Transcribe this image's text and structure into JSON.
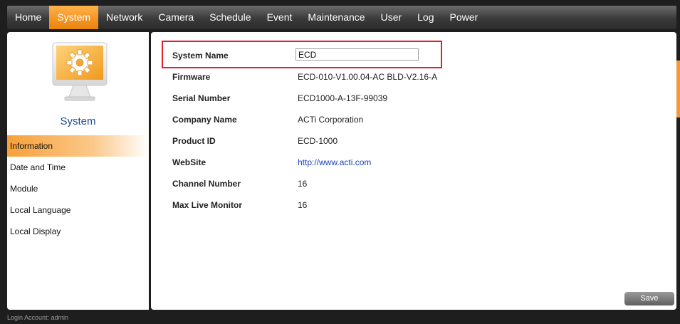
{
  "nav": {
    "tabs": [
      {
        "label": "Home"
      },
      {
        "label": "System"
      },
      {
        "label": "Network"
      },
      {
        "label": "Camera"
      },
      {
        "label": "Schedule"
      },
      {
        "label": "Event"
      },
      {
        "label": "Maintenance"
      },
      {
        "label": "User"
      },
      {
        "label": "Log"
      },
      {
        "label": "Power"
      }
    ],
    "active": "System"
  },
  "sidebar": {
    "title": "System",
    "icon": "gear-monitor-icon",
    "items": [
      {
        "label": "Information"
      },
      {
        "label": "Date and Time"
      },
      {
        "label": "Module"
      },
      {
        "label": "Local Language"
      },
      {
        "label": "Local Display"
      }
    ],
    "active": "Information"
  },
  "info": {
    "system_name": {
      "label": "System Name",
      "value": "ECD"
    },
    "firmware": {
      "label": "Firmware",
      "value": "ECD-010-V1.00.04-AC BLD-V2.16-A"
    },
    "serial": {
      "label": "Serial Number",
      "value": "ECD1000-A-13F-99039"
    },
    "company": {
      "label": "Company Name",
      "value": "ACTi Corporation"
    },
    "product": {
      "label": "Product ID",
      "value": "ECD-1000"
    },
    "website": {
      "label": "WebSite",
      "value": "http://www.acti.com"
    },
    "channel": {
      "label": "Channel Number",
      "value": "16"
    },
    "monitor": {
      "label": "Max Live Monitor",
      "value": "16"
    }
  },
  "actions": {
    "save_label": "Save"
  },
  "footer": {
    "login": "Login Account: admin"
  },
  "colors": {
    "accent": "#f39420",
    "highlight": "#e0202a",
    "link": "#1a3fbf",
    "title": "#1f4d8c"
  }
}
